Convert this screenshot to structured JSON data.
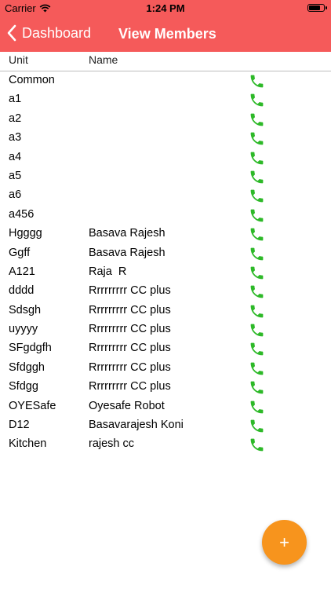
{
  "status_bar": {
    "carrier": "Carrier",
    "time": "1:24 PM"
  },
  "nav": {
    "back_label": "Dashboard",
    "title": "View Members"
  },
  "table": {
    "headers": {
      "unit": "Unit",
      "name": "Name"
    },
    "rows": [
      {
        "unit": "Common",
        "name": ""
      },
      {
        "unit": "a1",
        "name": ""
      },
      {
        "unit": "a2",
        "name": ""
      },
      {
        "unit": "a3",
        "name": ""
      },
      {
        "unit": "a4",
        "name": ""
      },
      {
        "unit": "a5",
        "name": ""
      },
      {
        "unit": "a6",
        "name": ""
      },
      {
        "unit": "a456",
        "name": ""
      },
      {
        "unit": "Hgggg",
        "name": "Basava Rajesh"
      },
      {
        "unit": "Ggff",
        "name": "Basava Rajesh"
      },
      {
        "unit": "A121",
        "name": "Raja  R"
      },
      {
        "unit": "dddd",
        "name": "Rrrrrrrrr CC plus"
      },
      {
        "unit": "Sdsgh",
        "name": "Rrrrrrrrr CC plus"
      },
      {
        "unit": "uyyyy",
        "name": "Rrrrrrrrr CC plus"
      },
      {
        "unit": "SFgdgfh",
        "name": "Rrrrrrrrr CC plus"
      },
      {
        "unit": "Sfdggh",
        "name": "Rrrrrrrrr CC plus"
      },
      {
        "unit": "Sfdgg",
        "name": "Rrrrrrrrr CC plus"
      },
      {
        "unit": "OYESafe",
        "name": "Oyesafe Robot"
      },
      {
        "unit": "D12",
        "name": "Basavarajesh Koni"
      },
      {
        "unit": "Kitchen",
        "name": "rajesh cc"
      }
    ]
  },
  "fab": {
    "label": "+"
  },
  "icons": {
    "call": "phone-icon",
    "back": "chevron-left-icon",
    "wifi": "wifi-icon",
    "battery": "battery-icon"
  },
  "colors": {
    "header": "#f55a5a",
    "phone": "#2db928",
    "fab": "#f7941d"
  }
}
